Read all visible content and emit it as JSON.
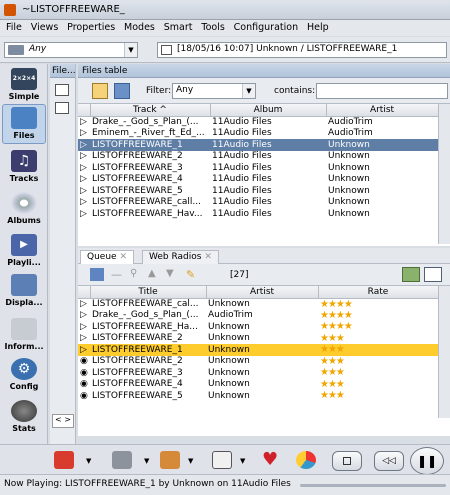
{
  "window": {
    "title": "~LISTOFFREEWARE_"
  },
  "menu": [
    "File",
    "Views",
    "Properties",
    "Modes",
    "Smart",
    "Tools",
    "Configuration",
    "Help"
  ],
  "toolbar": {
    "filter_combo": "Any",
    "now_path": "[18/05/16 10:07] Unknown / LISTOFFREEWARE_1"
  },
  "nav": [
    {
      "label": "Simple",
      "icon": "simple-icon"
    },
    {
      "label": "Files",
      "icon": "folder-icon"
    },
    {
      "label": "Tracks",
      "icon": "music-note-icon"
    },
    {
      "label": "Albums",
      "icon": "disc-icon"
    },
    {
      "label": "Playli...",
      "icon": "playlist-icon"
    },
    {
      "label": "Displa...",
      "icon": "display-icon"
    },
    {
      "label": "Inform...",
      "icon": "info-icon"
    },
    {
      "label": "Config",
      "icon": "gear-icon"
    },
    {
      "label": "Stats",
      "icon": "stats-icon"
    }
  ],
  "files_col_label": "File...",
  "files_table": {
    "title": "Files table",
    "filter_label": "Filter:",
    "filter_value": "Any",
    "contains_label": "contains:",
    "columns": [
      "Track ^",
      "Album",
      "Artist"
    ],
    "rows": [
      {
        "track": "Drake_-_God_s_Plan_(...",
        "album": "11Audio Files",
        "artist": "AudioTrim"
      },
      {
        "track": "Eminem_-_River_ft_Ed_...",
        "album": "11Audio Files",
        "artist": "AudioTrim"
      },
      {
        "track": "LISTOFFREEWARE_1",
        "album": "11Audio Files",
        "artist": "Unknown"
      },
      {
        "track": "LISTOFFREEWARE_2",
        "album": "11Audio Files",
        "artist": "Unknown"
      },
      {
        "track": "LISTOFFREEWARE_3",
        "album": "11Audio Files",
        "artist": "Unknown"
      },
      {
        "track": "LISTOFFREEWARE_4",
        "album": "11Audio Files",
        "artist": "Unknown"
      },
      {
        "track": "LISTOFFREEWARE_5",
        "album": "11Audio Files",
        "artist": "Unknown"
      },
      {
        "track": "LISTOFFREEWARE_call...",
        "album": "11Audio Files",
        "artist": "Unknown"
      },
      {
        "track": "LISTOFFREEWARE_Hav...",
        "album": "11Audio Files",
        "artist": "Unknown"
      }
    ]
  },
  "queue": {
    "tabs": [
      "Queue",
      "Web Radios"
    ],
    "count": "[27]",
    "columns": [
      "Title",
      "Artist",
      "Rate"
    ],
    "rows": [
      {
        "title": "LISTOFFREEWARE_cal...",
        "artist": "Unknown",
        "rate": 4
      },
      {
        "title": "Drake_-_God_s_Plan_(...",
        "artist": "AudioTrim",
        "rate": 4
      },
      {
        "title": "LISTOFFREEWARE_Ha...",
        "artist": "Unknown",
        "rate": 4
      },
      {
        "title": "LISTOFFREEWARE_2",
        "artist": "Unknown",
        "rate": 3
      },
      {
        "title": "LISTOFFREEWARE_1",
        "artist": "Unknown",
        "rate": 3
      },
      {
        "title": "LISTOFFREEWARE_2",
        "artist": "Unknown",
        "rate": 3
      },
      {
        "title": "LISTOFFREEWARE_3",
        "artist": "Unknown",
        "rate": 3
      },
      {
        "title": "LISTOFFREEWARE_4",
        "artist": "Unknown",
        "rate": 3
      },
      {
        "title": "LISTOFFREEWARE_5",
        "artist": "Unknown",
        "rate": 3
      }
    ]
  },
  "status": {
    "now_playing": "Now Playing:  LISTOFFREEWARE_1 by Unknown on 11Audio Files"
  },
  "colors": {
    "selected_row": "#5f7ea6",
    "playing_row": "#fecc2c",
    "star": "#f0a500"
  }
}
